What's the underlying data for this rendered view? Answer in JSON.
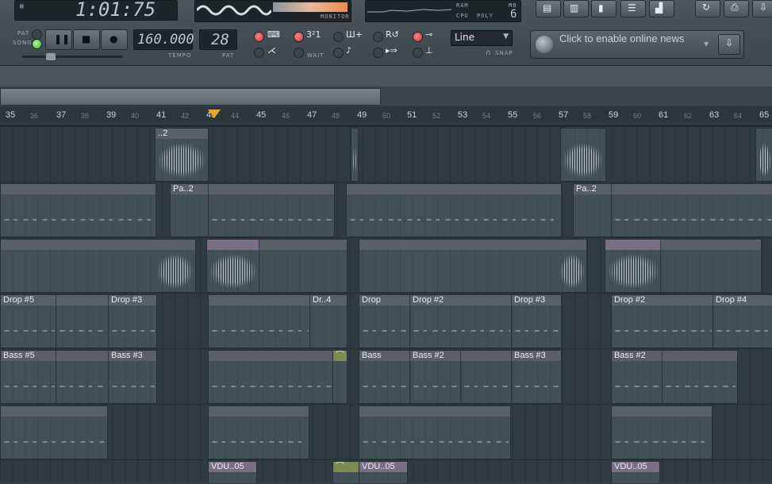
{
  "toolbar": {
    "song_time": "1:01:75",
    "monitor_label": "MONITOR",
    "ram_label": "RAM",
    "mb_label": "MB",
    "cpu_label": "CPU",
    "poly_label": "POLY",
    "poly_value": "6",
    "pat_label": "PAT",
    "song_label": "SONG",
    "tempo_value": "160.000",
    "tempo_label": "TEMPO",
    "pattern_value": "28",
    "pattern_label": "PAT",
    "wait_label": "WAIT",
    "snap_value": "Line",
    "snap_label": "SNAP",
    "news_text": "Click to enable online news"
  },
  "ruler": {
    "major": [
      "35",
      "37",
      "39",
      "41",
      "43",
      "45",
      "47",
      "49",
      "51",
      "53",
      "55",
      "57",
      "59",
      "61",
      "63",
      "65"
    ],
    "minor": [
      "36",
      "38",
      "40",
      "42",
      "44",
      "46",
      "48",
      "50",
      "52",
      "54",
      "56",
      "58",
      "60",
      "62",
      "64"
    ]
  },
  "tracks": {
    "row1": [
      "..2"
    ],
    "row2": [
      "Pa..2",
      "Pa..2"
    ],
    "row4": [
      "Drop #5",
      "Drop #3",
      "Dr..4",
      "Drop",
      "Drop #2",
      "Drop #3",
      "Drop #2",
      "Drop #4"
    ],
    "row5": [
      "Bass #5",
      "Bass #3",
      "Bass",
      "Bass #2",
      "Bass #3",
      "Bass #2"
    ],
    "row7": [
      "VDU..05",
      "VDU..05",
      "VDU..05"
    ]
  },
  "colors": {
    "playhead": "#f0a31d",
    "clip_header": "#566066",
    "clip_header_purple": "#7b6f86",
    "automation_green": "#7c8a55",
    "led_red": "#d22a2a",
    "led_green": "#3fae34"
  }
}
